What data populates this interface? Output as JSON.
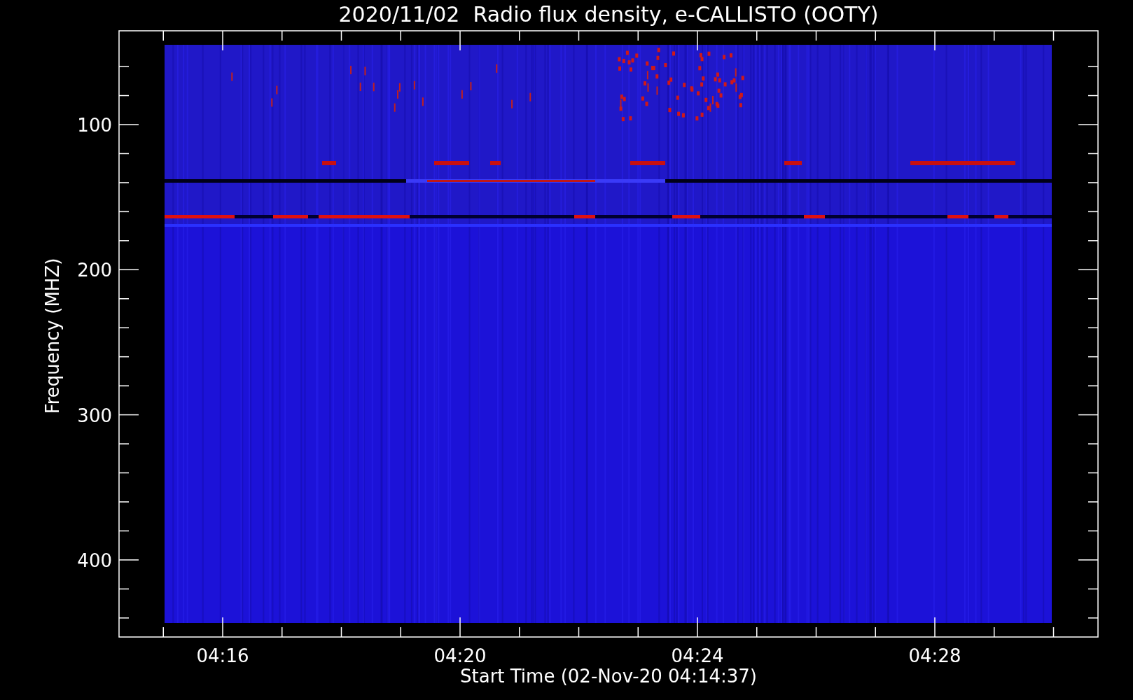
{
  "title": "2020/11/02  Radio flux density, e-CALLISTO (OOTY)",
  "y_axis": {
    "label": "Frequency (MHZ)",
    "ticks": [
      "100",
      "200",
      "300",
      "400"
    ]
  },
  "x_axis": {
    "label": "Start Time (02-Nov-20 04:14:37)",
    "ticks": [
      "04:16",
      "04:20",
      "04:24",
      "04:28"
    ]
  }
}
